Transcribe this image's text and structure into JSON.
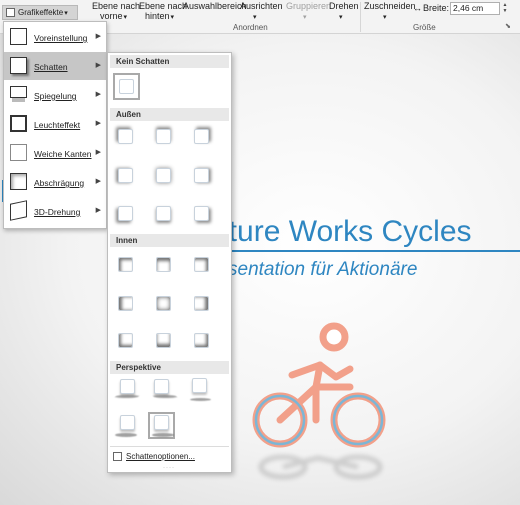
{
  "ribbon": {
    "grafikeffekte_label": "Grafikeffekte",
    "ebene_vorne_line1": "Ebene nach",
    "ebene_vorne_line2": "vorne",
    "ebene_hinten_line1": "Ebene nach",
    "ebene_hinten_line2": "hinten",
    "auswahlbereich_label": "Auswahlbereich",
    "ausrichten_label": "Ausrichten",
    "gruppieren_label": "Gruppieren",
    "drehen_label": "Drehen",
    "anordnen_group": "Anordnen",
    "zuschneiden_label": "Zuschneiden",
    "breite_label": "Breite:",
    "breite_value": "2,46 cm",
    "groesse_group": "Größe"
  },
  "menu1": {
    "items": [
      {
        "label": "Voreinstellung",
        "icon": "voreinstellung-icon"
      },
      {
        "label": "Schatten",
        "icon": "schatten-icon"
      },
      {
        "label": "Spiegelung",
        "icon": "spiegelung-icon"
      },
      {
        "label": "Leuchteffekt",
        "icon": "leuchteffekt-icon"
      },
      {
        "label": "Weiche Kanten",
        "icon": "weiche-kanten-icon"
      },
      {
        "label": "Abschrägung",
        "icon": "abschraegung-icon"
      },
      {
        "label": "3D-Drehung",
        "icon": "3d-drehung-icon"
      }
    ],
    "selected": "Schatten"
  },
  "menu2": {
    "sections": {
      "kein_schatten": "Kein Schatten",
      "aussen": "Außen",
      "innen": "Innen",
      "perspektive": "Perspektive"
    },
    "options_label": "Schattenoptionen..."
  },
  "slide": {
    "title": "nture Works Cycles",
    "subtitle": "sentation für Aktionäre"
  },
  "colors": {
    "accent": "#2e86c1",
    "bike_fill": "#f2a08a",
    "menu_selected": "#c6c6c6"
  }
}
